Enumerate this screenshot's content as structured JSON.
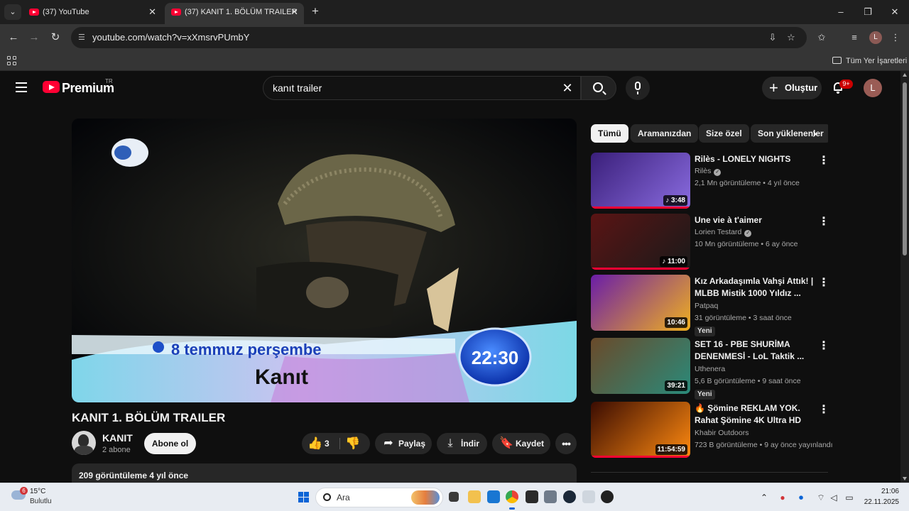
{
  "browser": {
    "tabs": [
      {
        "title": "(37) YouTube",
        "close": "✕"
      },
      {
        "title": "(37) KANIT 1. BÖLÜM TRAILER",
        "close": "✕"
      }
    ],
    "new_tab": "+",
    "window_controls": {
      "minimize": "–",
      "maximize": "❐",
      "close": "✕"
    },
    "url": "youtube.com/watch?v=xXmsrvPUmbY",
    "profile_initial": "L",
    "bookmarks_label": "Tüm Yer İşaretleri"
  },
  "masthead": {
    "logo_text": "Premium",
    "country_code": "TR",
    "search_query": "kanıt trailer",
    "clear_glyph": "✕",
    "create_label": "Oluştur",
    "create_glyph": "+",
    "notification_count": "9+",
    "avatar_initial": "L"
  },
  "player": {
    "overlay_date": "8 temmuz perşembe",
    "overlay_time": "22:30",
    "overlay_show": "Kanıt"
  },
  "video": {
    "title": "KANIT 1. BÖLÜM TRAILER",
    "channel_name": "KANIT",
    "subscribers": "2 abone",
    "subscribe_label": "Abone ol",
    "like_count": "3",
    "like_glyph": "👍",
    "dislike_glyph": "👎",
    "share_label": "Paylaş",
    "share_glyph": "➦",
    "download_label": "İndir",
    "download_glyph": "⤓",
    "save_label": "Kaydet",
    "save_glyph": "🔖",
    "more_glyph": "•••",
    "description_meta": "209 görüntüleme  4 yıl önce"
  },
  "chips": [
    "Tümü",
    "Aramanızdan",
    "Size özel",
    "Son yüklenenler"
  ],
  "chip_next_glyph": "›",
  "recommendations": [
    {
      "title": "Rilès - LONELY NIGHTS",
      "channel": "Rilès",
      "verified": true,
      "stats": "2,1 Mn görüntüleme • 4 yıl önce",
      "duration": "♪ 3:48",
      "badge": "",
      "progress_fraction": 1.0,
      "thumb_colors": [
        "#3a1f7a",
        "#8a6ce0"
      ]
    },
    {
      "title": "Une vie à t'aimer",
      "channel": "Lorien Testard",
      "verified": true,
      "stats": "10 Mn görüntüleme • 6 ay önce",
      "duration": "♪ 11:00",
      "badge": "",
      "progress_fraction": 1.0,
      "thumb_colors": [
        "#5a1414",
        "#1a1a1a"
      ]
    },
    {
      "title": "Kız Arkadaşımla Vahşi Attık! | MLBB Mistik 1000 Yıldız ...",
      "channel": "Patpaq",
      "verified": false,
      "stats": "31 görüntüleme • 3 saat önce",
      "duration": "10:46",
      "badge": "Yeni",
      "progress_fraction": 0,
      "thumb_colors": [
        "#6a1da8",
        "#f0b020"
      ]
    },
    {
      "title": "SET 16 - PBE SHURİMA DENENMESİ - LoL Taktik ...",
      "channel": "Uthenera",
      "verified": false,
      "stats": "5,6 B görüntüleme • 9 saat önce",
      "duration": "39:21",
      "badge": "Yeni",
      "progress_fraction": 0,
      "thumb_colors": [
        "#6a4a2a",
        "#2a8a7a"
      ]
    },
    {
      "title": "🔥 Şömine REKLAM YOK. Rahat Şömine 4K Ultra HD",
      "channel": "Khabir Outdoors",
      "verified": false,
      "stats": "723 B görüntüleme • 9 ay önce yayınlandı",
      "duration": "11:54:59",
      "badge": "",
      "progress_fraction": 1.0,
      "thumb_colors": [
        "#3a0c02",
        "#ff8a10"
      ]
    }
  ],
  "menu_glyph": "⋮",
  "taskbar": {
    "weather_temp": "15°C",
    "weather_desc": "Bulutlu",
    "weather_badge": "6",
    "search_label": "Ara",
    "time": "21:06",
    "date": "22.11.2025"
  }
}
